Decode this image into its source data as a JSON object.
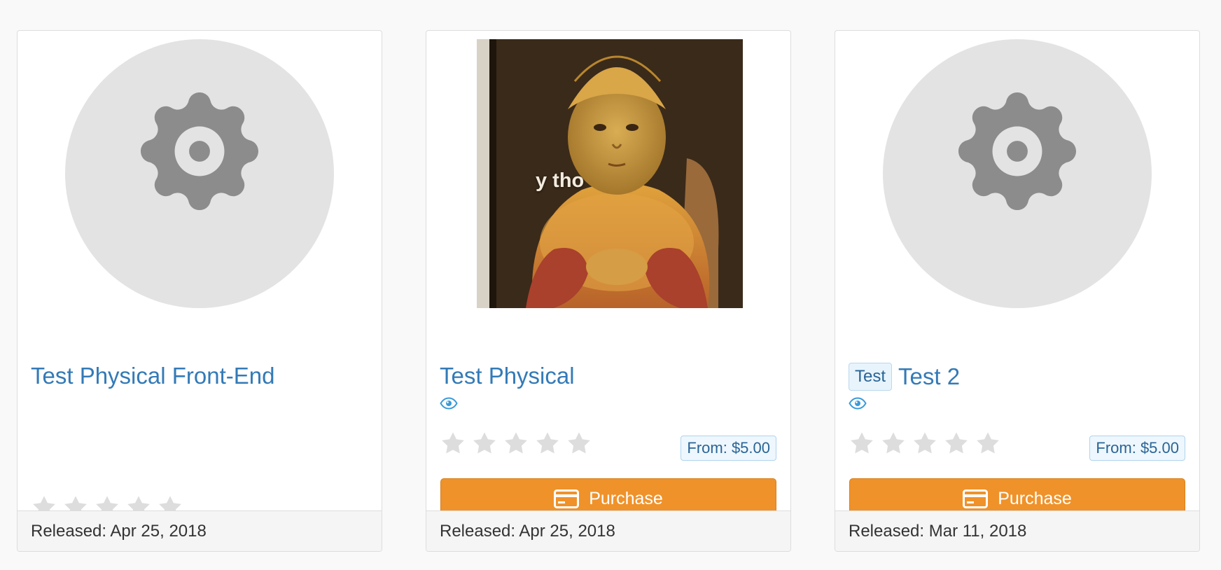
{
  "products": [
    {
      "title": "Test Physical Front-End",
      "image": "gear-placeholder",
      "rating": 0,
      "footer": "Released: Apr 25, 2018"
    },
    {
      "title": "Test Physical",
      "image": "meme-photo",
      "image_caption": "y tho",
      "rating": 0,
      "price": "From: $5.00",
      "button": "Purchase",
      "footer": "Released: Apr 25, 2018"
    },
    {
      "tag": "Test",
      "title": "Test 2",
      "image": "gear-placeholder",
      "rating": 0,
      "price": "From: $5.00",
      "button": "Purchase",
      "footer": "Released: Mar 11, 2018"
    }
  ],
  "icons": {
    "placeholder": "gear-icon",
    "view": "eye-icon",
    "rating": "star-icon",
    "purchase": "credit-card-icon"
  },
  "colors": {
    "link": "#337ab7",
    "button": "#ef922a",
    "star_empty": "#dddddd",
    "placeholder_bg": "#e3e3e3",
    "gear": "#8c8c8c"
  }
}
